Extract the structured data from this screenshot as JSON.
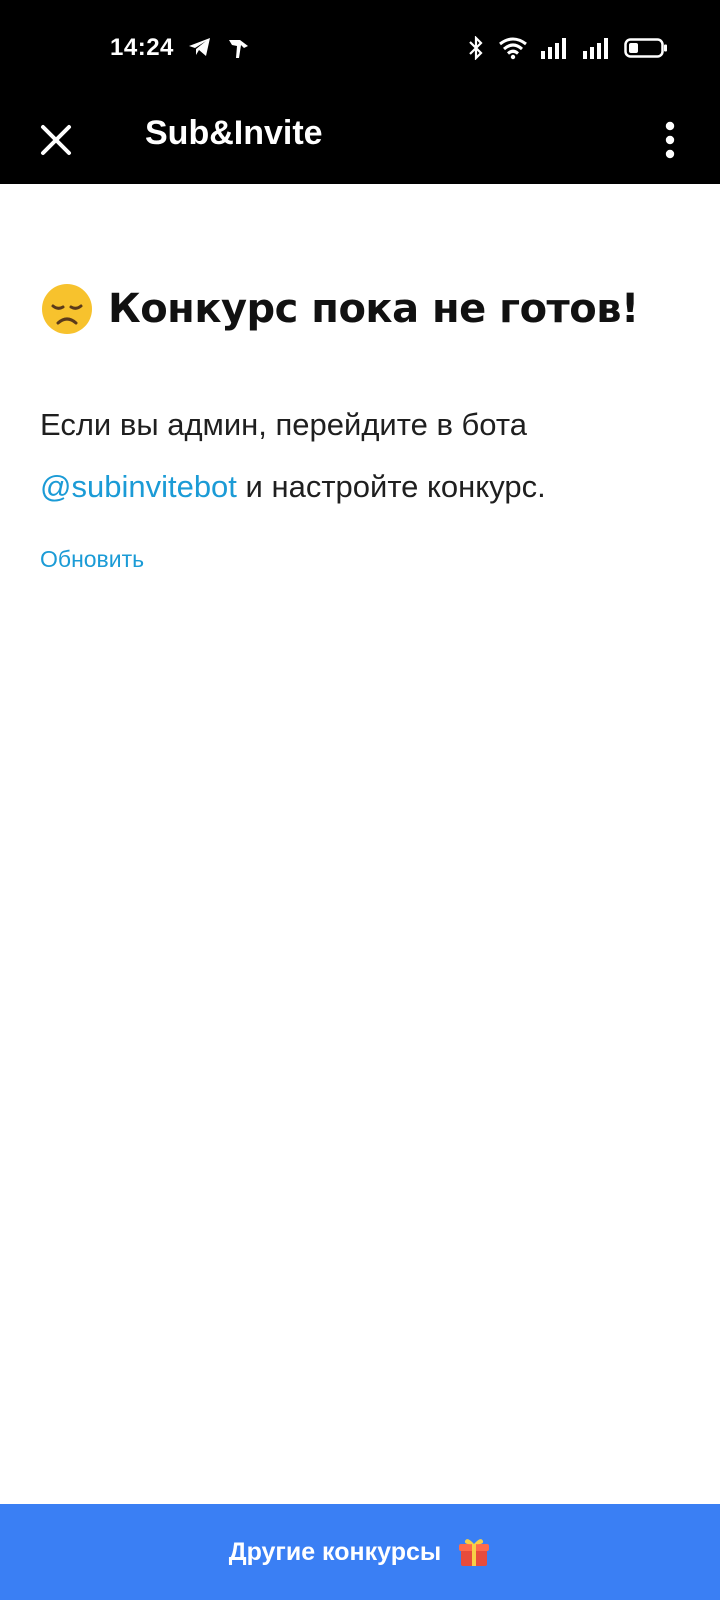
{
  "status_bar": {
    "time": "14:24",
    "left_icons": [
      "telegram-icon",
      "notification-icon"
    ],
    "right_icons": [
      "bluetooth-icon",
      "wifi-icon",
      "signal-icon",
      "signal-icon",
      "battery-icon"
    ],
    "battery_level": 0.3
  },
  "top_bar": {
    "title": "Sub&Invite",
    "close_icon": "close-icon",
    "menu_icon": "more-vertical-icon"
  },
  "main": {
    "heading_emoji": "disappointed-face-icon",
    "heading": "Конкурс пока не готов!",
    "body_before": "Если вы админ, перейдите в бота ",
    "bot_link": "@subinvitebot",
    "body_after": " и настройте конкурс.",
    "refresh_label": "Обновить"
  },
  "bottom_button": {
    "label": "Другие конкурсы",
    "icon": "gift-icon"
  },
  "colors": {
    "top_background": "#000000",
    "link": "#1b9bd6",
    "bottom_button": "#3a7ff4"
  }
}
